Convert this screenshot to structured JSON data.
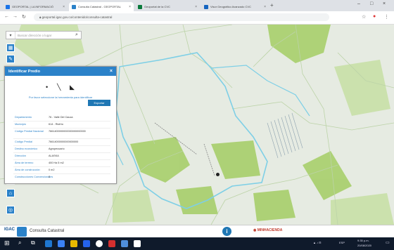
{
  "browser": {
    "tabs": [
      {
        "label": "GEOPORTAL | LA INFORMACIÓ",
        "color": "#1a73e8"
      },
      {
        "label": "Consulta Catastral - GEOPORTAL",
        "color": "#2b82c9"
      },
      {
        "label": "Geoportal de la CVC",
        "color": "#0a7a3c"
      },
      {
        "label": "Visor Geográfico Avanzado CVC",
        "color": "#1565c0"
      }
    ],
    "url": "geoportal.igac.gov.co/contenido/consulta-catastral"
  },
  "map": {
    "search_placeholder": "Buscar dirección o lugar",
    "panel": {
      "title": "Identificar Predio",
      "hint": "Por favor seleccione la herramienta para identificar",
      "export_label": "Exportar",
      "rows": [
        {
          "key": "Departamento",
          "value": "76 - Valle Del Cauca"
        },
        {
          "key": "Municipio",
          "value": "614 - Riofrío"
        },
        {
          "key": "Código Predial Nacional",
          "value": "7661400000000000000000000"
        },
        {
          "key": "Código Predial",
          "value": "76614000000000000000"
        },
        {
          "key": "Destino económico",
          "value": "Agropecuario"
        },
        {
          "key": "Dirección",
          "value": "ALASKA"
        },
        {
          "key": "Área de terreno",
          "value": "400 Ha 5 m2"
        },
        {
          "key": "Área de construcción",
          "value": "0 m2"
        },
        {
          "key": "Construcciones Convencionales",
          "value": "0"
        }
      ]
    }
  },
  "footer": {
    "logo_text": "IGAC",
    "title": "Consulta Catastral",
    "partner": "MINHACIENDA"
  },
  "taskbar": {
    "time": "9:35 p.m.",
    "date": "20/08/2020",
    "lang": "ESP"
  },
  "colors": {
    "accent": "#2b82c9",
    "parcel_outline": "#7ecfe6",
    "green_parcels": "#7fbf3f"
  }
}
